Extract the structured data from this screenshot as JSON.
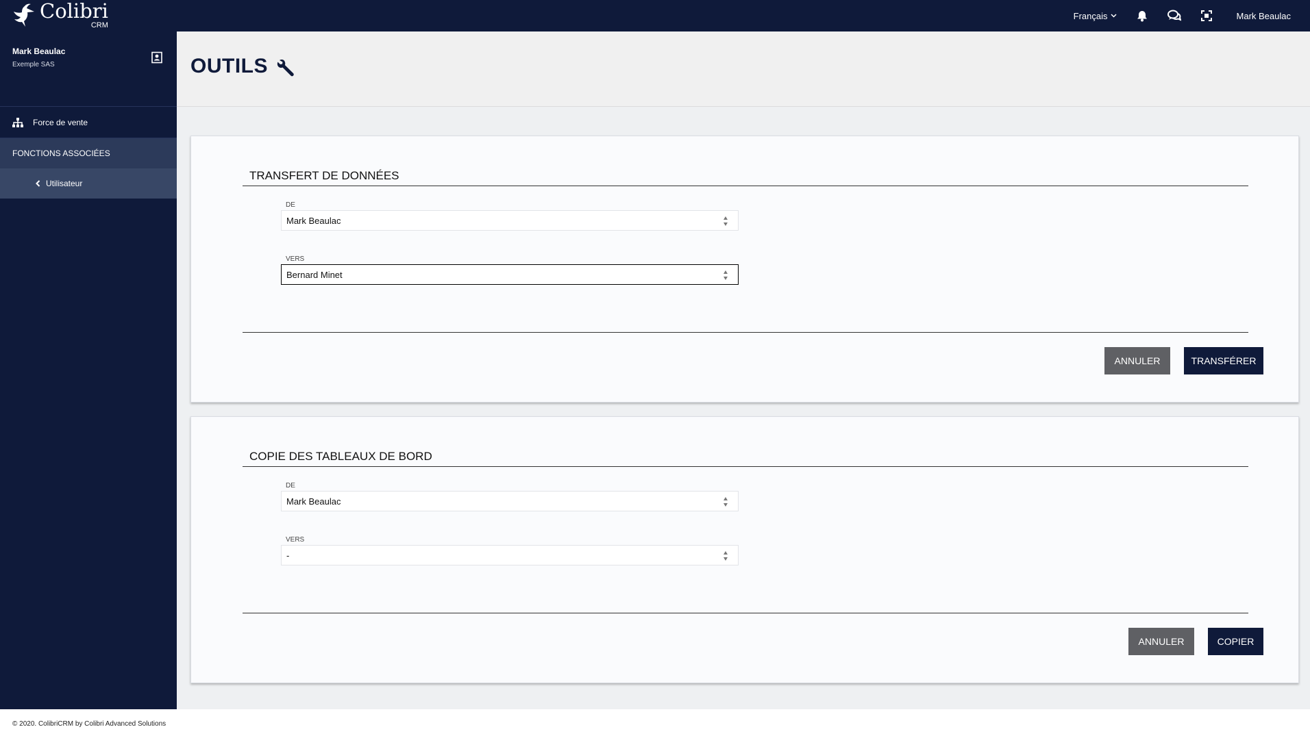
{
  "topbar": {
    "logo_name": "Colibri",
    "logo_sub": "CRM",
    "language": "Français",
    "user_name": "Mark Beaulac"
  },
  "sidebar": {
    "profile_name": "Mark Beaulac",
    "profile_company": "Exemple SAS",
    "nav_item": "Force de vente",
    "section_header": "FONCTIONS ASSOCIÉES",
    "sub_item": "Utilisateur"
  },
  "page": {
    "title": "OUTILS"
  },
  "transfer": {
    "title": "TRANSFERT DE DONNÉES",
    "from_label": "DE",
    "from_value": "Mark Beaulac",
    "to_label": "VERS",
    "to_value": "Bernard Minet",
    "cancel_label": "ANNULER",
    "submit_label": "TRANSFÉRER"
  },
  "copy": {
    "title": "COPIE DES TABLEAUX DE BORD",
    "from_label": "DE",
    "from_value": "Mark Beaulac",
    "to_label": "VERS",
    "to_value": "-",
    "cancel_label": "ANNULER",
    "submit_label": "COPIER"
  },
  "footer": {
    "text": "© 2020. ColibriCRM by Colibri Advanced Solutions"
  },
  "colors": {
    "navy": "#0f1a3a",
    "grey_button": "#5f6064",
    "section_bg": "#2c3a5a",
    "sub_item_bg": "#384766"
  }
}
